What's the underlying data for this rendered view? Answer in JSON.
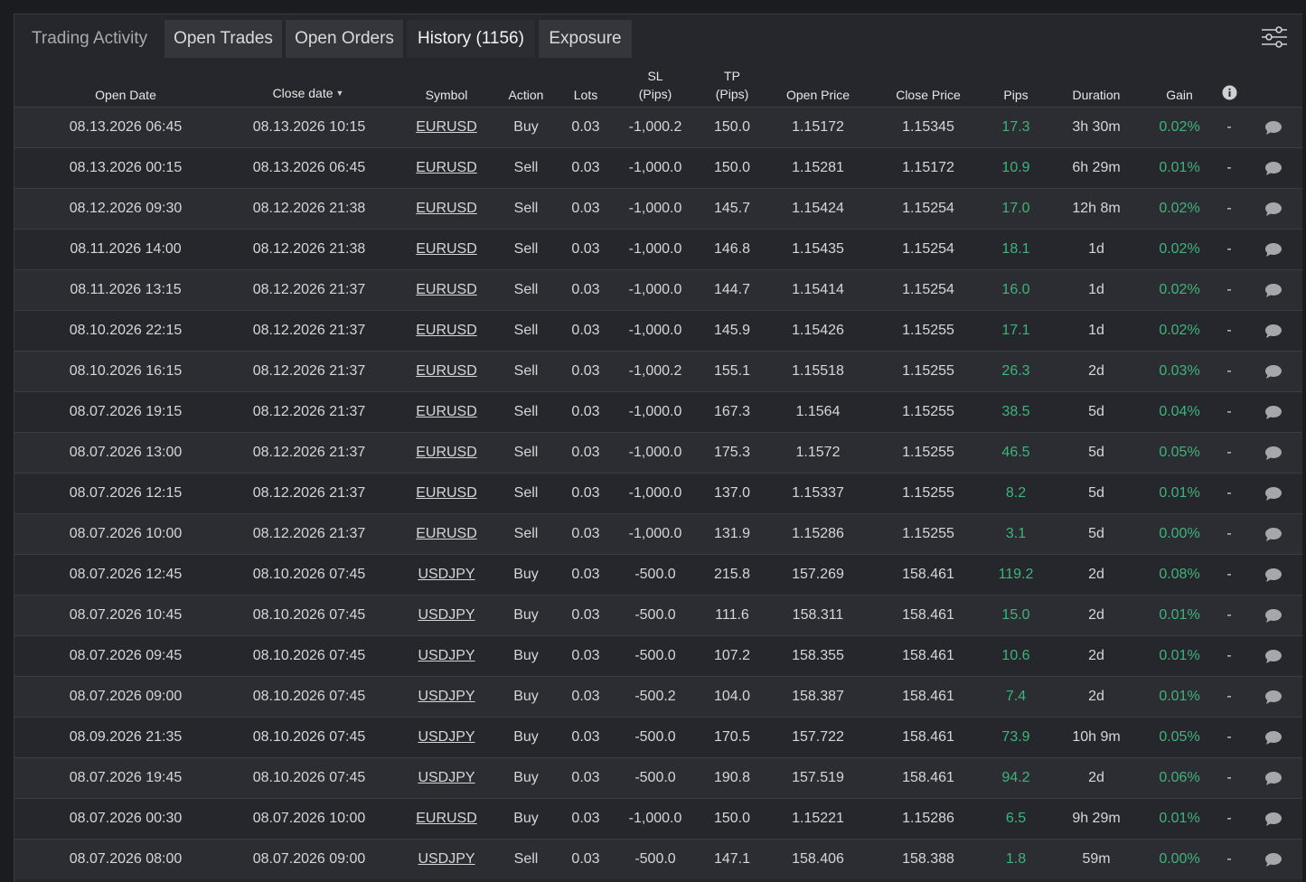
{
  "tabs": {
    "title": "Trading Activity",
    "open_trades": "Open Trades",
    "open_orders": "Open Orders",
    "history": "History (1156)",
    "exposure": "Exposure"
  },
  "columns": {
    "open_date": "Open Date",
    "close_date": "Close date",
    "sort_indicator": "▼",
    "symbol": "Symbol",
    "action": "Action",
    "lots": "Lots",
    "sl_1": "SL",
    "sl_2": "(Pips)",
    "tp_1": "TP",
    "tp_2": "(Pips)",
    "open_price": "Open Price",
    "close_price": "Close Price",
    "pips": "Pips",
    "duration": "Duration",
    "gain": "Gain"
  },
  "colors": {
    "positive": "#3eb47a",
    "background": "#26272c",
    "row_alt": "#2c2d32"
  },
  "rows": [
    {
      "open": "08.13.2026 06:45",
      "close": "08.13.2026 10:15",
      "symbol": "EURUSD",
      "action": "Buy",
      "lots": "0.03",
      "sl": "-1,000.2",
      "tp": "150.0",
      "open_price": "1.15172",
      "close_price": "1.15345",
      "pips": "17.3",
      "duration": "3h 30m",
      "gain": "0.02%",
      "note": "-"
    },
    {
      "open": "08.13.2026 00:15",
      "close": "08.13.2026 06:45",
      "symbol": "EURUSD",
      "action": "Sell",
      "lots": "0.03",
      "sl": "-1,000.0",
      "tp": "150.0",
      "open_price": "1.15281",
      "close_price": "1.15172",
      "pips": "10.9",
      "duration": "6h 29m",
      "gain": "0.01%",
      "note": "-"
    },
    {
      "open": "08.12.2026 09:30",
      "close": "08.12.2026 21:38",
      "symbol": "EURUSD",
      "action": "Sell",
      "lots": "0.03",
      "sl": "-1,000.0",
      "tp": "145.7",
      "open_price": "1.15424",
      "close_price": "1.15254",
      "pips": "17.0",
      "duration": "12h 8m",
      "gain": "0.02%",
      "note": "-"
    },
    {
      "open": "08.11.2026 14:00",
      "close": "08.12.2026 21:38",
      "symbol": "EURUSD",
      "action": "Sell",
      "lots": "0.03",
      "sl": "-1,000.0",
      "tp": "146.8",
      "open_price": "1.15435",
      "close_price": "1.15254",
      "pips": "18.1",
      "duration": "1d",
      "gain": "0.02%",
      "note": "-"
    },
    {
      "open": "08.11.2026 13:15",
      "close": "08.12.2026 21:37",
      "symbol": "EURUSD",
      "action": "Sell",
      "lots": "0.03",
      "sl": "-1,000.0",
      "tp": "144.7",
      "open_price": "1.15414",
      "close_price": "1.15254",
      "pips": "16.0",
      "duration": "1d",
      "gain": "0.02%",
      "note": "-"
    },
    {
      "open": "08.10.2026 22:15",
      "close": "08.12.2026 21:37",
      "symbol": "EURUSD",
      "action": "Sell",
      "lots": "0.03",
      "sl": "-1,000.0",
      "tp": "145.9",
      "open_price": "1.15426",
      "close_price": "1.15255",
      "pips": "17.1",
      "duration": "1d",
      "gain": "0.02%",
      "note": "-"
    },
    {
      "open": "08.10.2026 16:15",
      "close": "08.12.2026 21:37",
      "symbol": "EURUSD",
      "action": "Sell",
      "lots": "0.03",
      "sl": "-1,000.2",
      "tp": "155.1",
      "open_price": "1.15518",
      "close_price": "1.15255",
      "pips": "26.3",
      "duration": "2d",
      "gain": "0.03%",
      "note": "-"
    },
    {
      "open": "08.07.2026 19:15",
      "close": "08.12.2026 21:37",
      "symbol": "EURUSD",
      "action": "Sell",
      "lots": "0.03",
      "sl": "-1,000.0",
      "tp": "167.3",
      "open_price": "1.1564",
      "close_price": "1.15255",
      "pips": "38.5",
      "duration": "5d",
      "gain": "0.04%",
      "note": "-"
    },
    {
      "open": "08.07.2026 13:00",
      "close": "08.12.2026 21:37",
      "symbol": "EURUSD",
      "action": "Sell",
      "lots": "0.03",
      "sl": "-1,000.0",
      "tp": "175.3",
      "open_price": "1.1572",
      "close_price": "1.15255",
      "pips": "46.5",
      "duration": "5d",
      "gain": "0.05%",
      "note": "-"
    },
    {
      "open": "08.07.2026 12:15",
      "close": "08.12.2026 21:37",
      "symbol": "EURUSD",
      "action": "Sell",
      "lots": "0.03",
      "sl": "-1,000.0",
      "tp": "137.0",
      "open_price": "1.15337",
      "close_price": "1.15255",
      "pips": "8.2",
      "duration": "5d",
      "gain": "0.01%",
      "note": "-"
    },
    {
      "open": "08.07.2026 10:00",
      "close": "08.12.2026 21:37",
      "symbol": "EURUSD",
      "action": "Sell",
      "lots": "0.03",
      "sl": "-1,000.0",
      "tp": "131.9",
      "open_price": "1.15286",
      "close_price": "1.15255",
      "pips": "3.1",
      "duration": "5d",
      "gain": "0.00%",
      "note": "-"
    },
    {
      "open": "08.07.2026 12:45",
      "close": "08.10.2026 07:45",
      "symbol": "USDJPY",
      "action": "Buy",
      "lots": "0.03",
      "sl": "-500.0",
      "tp": "215.8",
      "open_price": "157.269",
      "close_price": "158.461",
      "pips": "119.2",
      "duration": "2d",
      "gain": "0.08%",
      "note": "-"
    },
    {
      "open": "08.07.2026 10:45",
      "close": "08.10.2026 07:45",
      "symbol": "USDJPY",
      "action": "Buy",
      "lots": "0.03",
      "sl": "-500.0",
      "tp": "111.6",
      "open_price": "158.311",
      "close_price": "158.461",
      "pips": "15.0",
      "duration": "2d",
      "gain": "0.01%",
      "note": "-"
    },
    {
      "open": "08.07.2026 09:45",
      "close": "08.10.2026 07:45",
      "symbol": "USDJPY",
      "action": "Buy",
      "lots": "0.03",
      "sl": "-500.0",
      "tp": "107.2",
      "open_price": "158.355",
      "close_price": "158.461",
      "pips": "10.6",
      "duration": "2d",
      "gain": "0.01%",
      "note": "-"
    },
    {
      "open": "08.07.2026 09:00",
      "close": "08.10.2026 07:45",
      "symbol": "USDJPY",
      "action": "Buy",
      "lots": "0.03",
      "sl": "-500.2",
      "tp": "104.0",
      "open_price": "158.387",
      "close_price": "158.461",
      "pips": "7.4",
      "duration": "2d",
      "gain": "0.01%",
      "note": "-"
    },
    {
      "open": "08.09.2026 21:35",
      "close": "08.10.2026 07:45",
      "symbol": "USDJPY",
      "action": "Buy",
      "lots": "0.03",
      "sl": "-500.0",
      "tp": "170.5",
      "open_price": "157.722",
      "close_price": "158.461",
      "pips": "73.9",
      "duration": "10h 9m",
      "gain": "0.05%",
      "note": "-"
    },
    {
      "open": "08.07.2026 19:45",
      "close": "08.10.2026 07:45",
      "symbol": "USDJPY",
      "action": "Buy",
      "lots": "0.03",
      "sl": "-500.0",
      "tp": "190.8",
      "open_price": "157.519",
      "close_price": "158.461",
      "pips": "94.2",
      "duration": "2d",
      "gain": "0.06%",
      "note": "-"
    },
    {
      "open": "08.07.2026 00:30",
      "close": "08.07.2026 10:00",
      "symbol": "EURUSD",
      "action": "Buy",
      "lots": "0.03",
      "sl": "-1,000.0",
      "tp": "150.0",
      "open_price": "1.15221",
      "close_price": "1.15286",
      "pips": "6.5",
      "duration": "9h 29m",
      "gain": "0.01%",
      "note": "-"
    },
    {
      "open": "08.07.2026 08:00",
      "close": "08.07.2026 09:00",
      "symbol": "USDJPY",
      "action": "Sell",
      "lots": "0.03",
      "sl": "-500.0",
      "tp": "147.1",
      "open_price": "158.406",
      "close_price": "158.388",
      "pips": "1.8",
      "duration": "59m",
      "gain": "0.00%",
      "note": "-"
    }
  ]
}
